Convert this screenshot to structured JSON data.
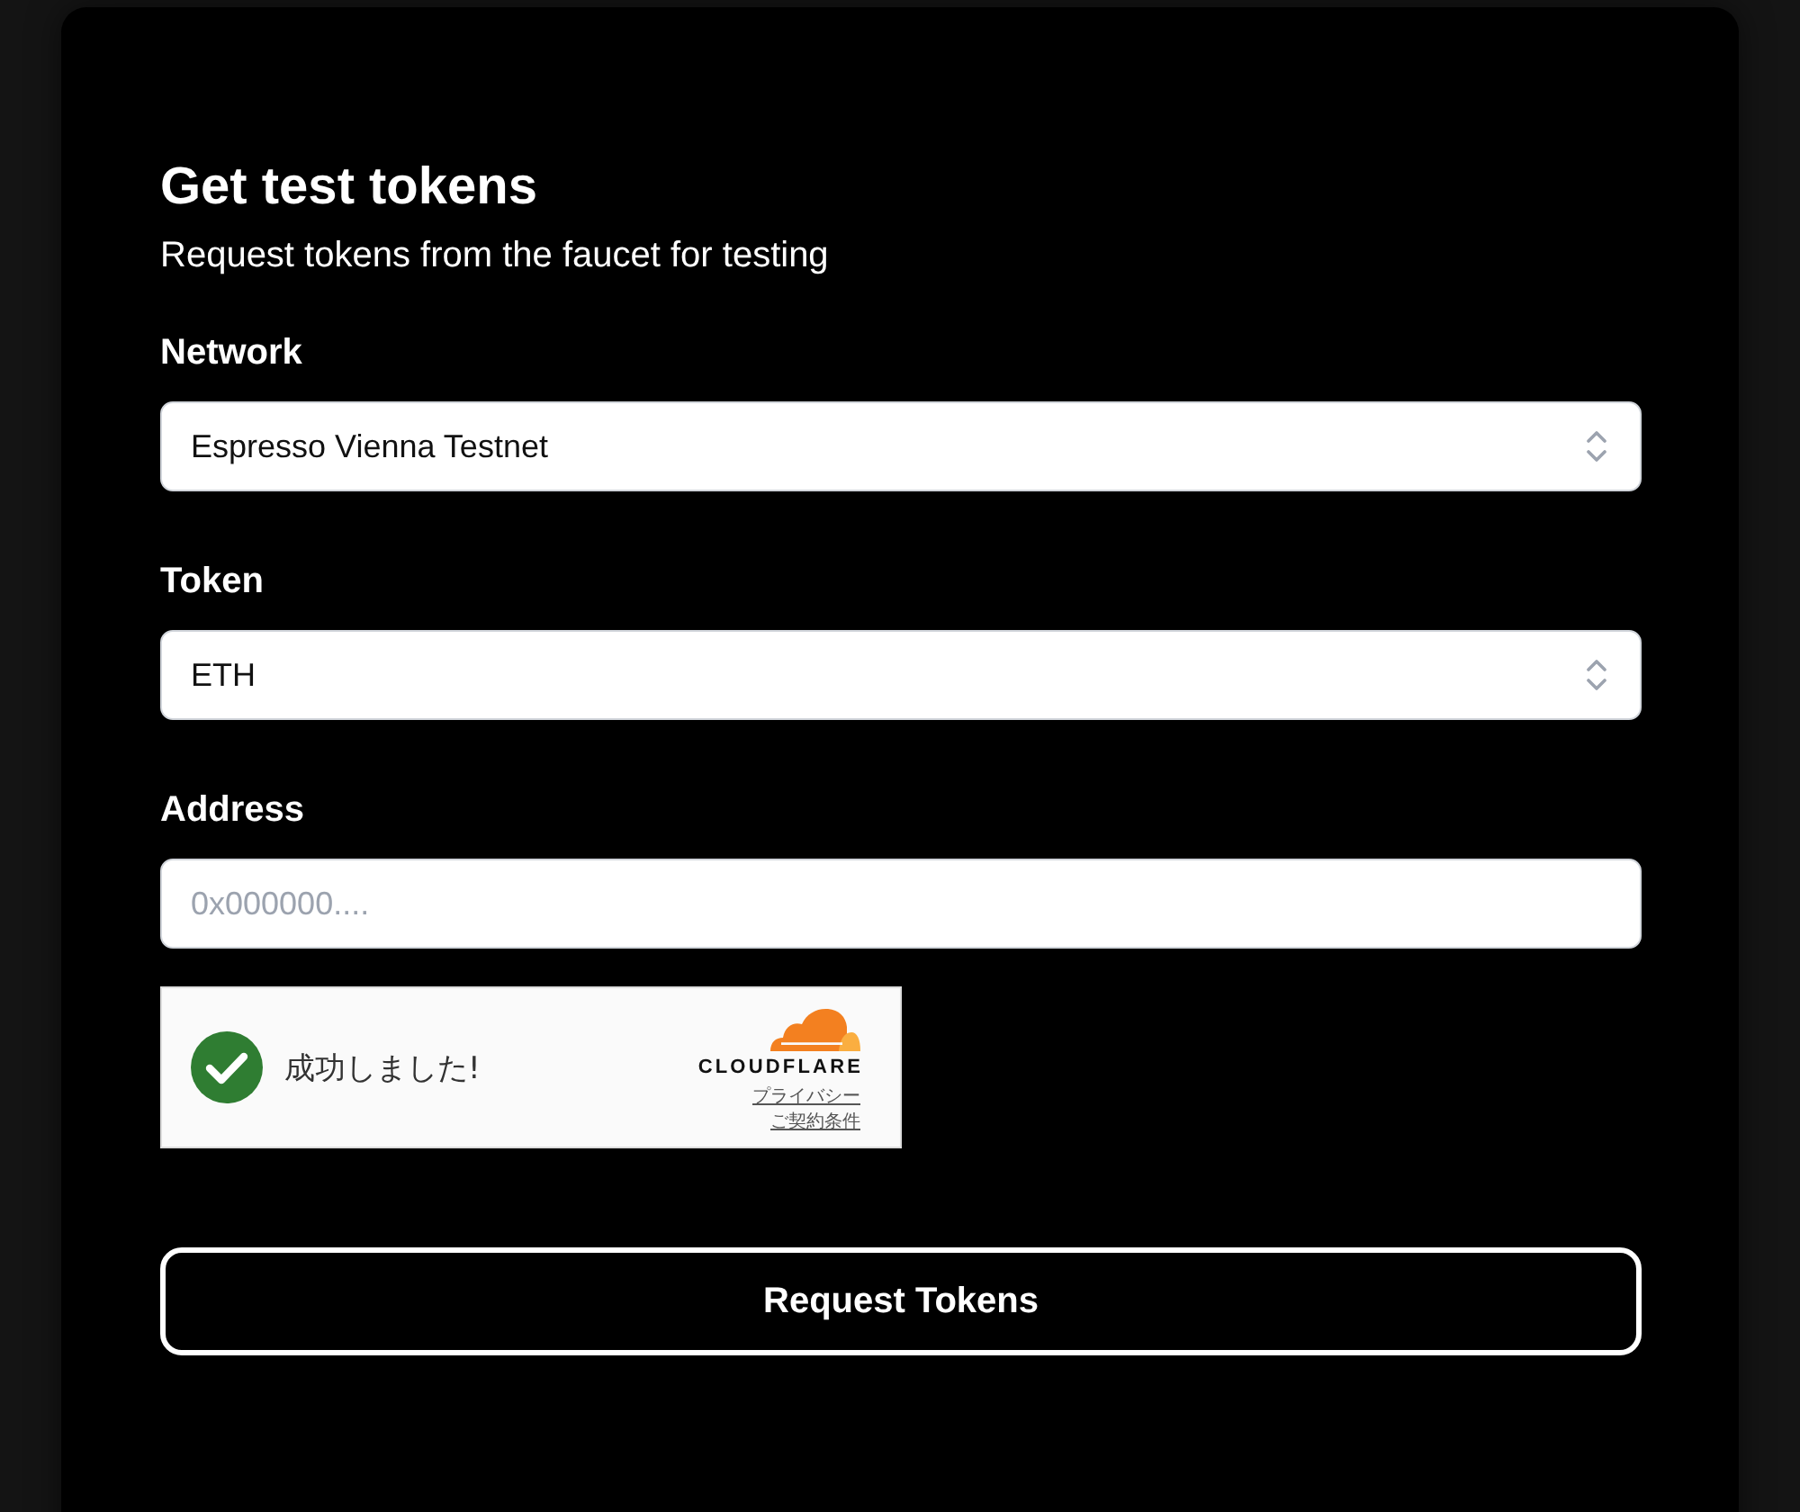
{
  "card": {
    "title": "Get test tokens",
    "subtitle": "Request tokens from the faucet for testing"
  },
  "fields": [
    {
      "kind": "select",
      "label": "Network",
      "value": "Espresso Vienna Testnet"
    },
    {
      "kind": "select",
      "label": "Token",
      "value": "ETH"
    },
    {
      "kind": "input",
      "label": "Address",
      "placeholder": "0x000000...."
    }
  ],
  "captcha": {
    "success": true,
    "status": "成功しました!",
    "brand": "CLOUDFLARE",
    "links": [
      "プライバシー",
      "ご契約条件"
    ]
  },
  "submit_button": "Request Tokens"
}
